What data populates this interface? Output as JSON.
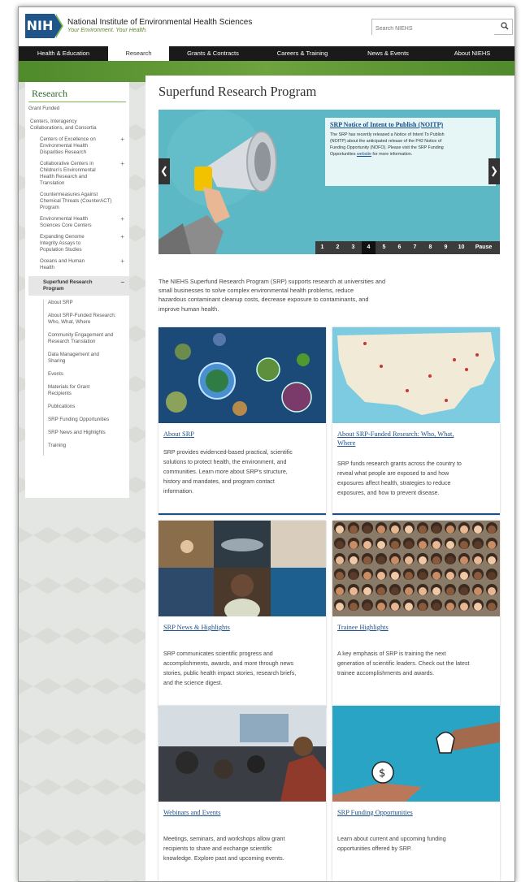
{
  "header": {
    "logo_text": "NIH",
    "institute_name": "National Institute of Environmental Health Sciences",
    "tagline": "Your Environment. Your Health.",
    "search_placeholder": "Search NIEHS"
  },
  "nav": [
    "Health & Education",
    "Research",
    "Grants & Contracts",
    "Careers & Training",
    "News & Events",
    "About NIEHS"
  ],
  "nav_active": "Research",
  "sidebar": {
    "heading": "Research",
    "grant_funded": "Grant Funded",
    "centers": [
      "Centers, Interagency",
      "Collaborations, and Consortia"
    ],
    "items": [
      {
        "lines": [
          "Centers of Excellence on",
          "Environmental Health",
          "Disparities Research"
        ],
        "expand": "+"
      },
      {
        "lines": [
          "Collaborative Centers in",
          "Children's Environmental",
          "Health Research and",
          "Translation"
        ],
        "expand": "+"
      },
      {
        "lines": [
          "Countermeasures Against",
          "Chemical Threats (CounterACT)",
          "Program"
        ],
        "expand": ""
      },
      {
        "lines": [
          "Environmental Health",
          "Sciences Core Centers"
        ],
        "expand": "+"
      },
      {
        "lines": [
          "Expanding Genome",
          "Integrity Assays to",
          "Population Studies"
        ],
        "expand": "+"
      },
      {
        "lines": [
          "Oceans and Human",
          "Health"
        ],
        "expand": "+"
      }
    ],
    "current": {
      "lines": [
        "Superfund Research",
        "Program"
      ],
      "expand": "−"
    },
    "subitems": [
      [
        "About SRP"
      ],
      [
        "About SRP-Funded Research:",
        "Who, What, Where"
      ],
      [
        "Community Engagement and",
        "Research Translation"
      ],
      [
        "Data Management and",
        "Sharing"
      ],
      [
        "Events"
      ],
      [
        "Materials for Grant",
        "Recipients"
      ],
      [
        "Publications"
      ],
      [
        "SRP Funding Opportunities"
      ],
      [
        "SRP News and Highlights"
      ],
      [
        "Training"
      ]
    ]
  },
  "main": {
    "title": "Superfund Research Program",
    "carousel": {
      "title": "SRP Notice of Intent to Publish (NOITP)",
      "text_lines": [
        "The SRP has recently released a Notice of Intent To Publish",
        "(NOITP) about the anticipated release of the P42 Notice of",
        "Funding Opportunity (NOFO).  Please visit the SRP Funding"
      ],
      "text_last_prefix": "Opportunities ",
      "text_link": "website",
      "text_last_suffix": " for more information.",
      "pages": [
        "1",
        "2",
        "3",
        "4",
        "5",
        "6",
        "7",
        "8",
        "9",
        "10"
      ],
      "active_page": "4",
      "pause_label": "Pause"
    },
    "intro_lines": [
      "The NIEHS Superfund Research Program (SRP) supports research at universities and",
      "small businesses to solve complex environmental health problems, reduce",
      "hazardous contaminant cleanup costs, decrease exposure to contaminants, and",
      "improve human health."
    ],
    "cards": [
      {
        "title_lines": [
          "About SRP"
        ],
        "desc_lines": [
          "SRP provides evidenced-based practical, scientific",
          "solutions to protect health, the environment, and",
          "communities. Learn more about SRP's structure,",
          "history and mandates, and program contact",
          "information."
        ]
      },
      {
        "title_lines": [
          "About SRP-Funded Research: Who, What,",
          "Where"
        ],
        "desc_lines": [
          "SRP funds research grants across the country to",
          "reveal what people are exposed to and how",
          "exposures affect health, strategies to reduce",
          "exposures, and how to prevent disease."
        ]
      },
      {
        "title_lines": [
          "SRP News & Highlights"
        ],
        "desc_lines": [
          "SRP communicates scientific progress and",
          "accomplishments, awards, and more through news",
          "stories, public health impact stories, research briefs,",
          "and the science digest."
        ]
      },
      {
        "title_lines": [
          "Trainee Highlights"
        ],
        "desc_lines": [
          "A key emphasis of SRP is training the next",
          "generation of scientific leaders. Check out the latest",
          "trainee accomplishments and awards."
        ]
      },
      {
        "title_lines": [
          "Webinars and Events"
        ],
        "desc_lines": [
          "Meetings, seminars, and workshops allow grant",
          "recipients to share and exchange scientific",
          "knowledge. Explore past and upcoming events."
        ]
      },
      {
        "title_lines": [
          "SRP Funding Opportunities"
        ],
        "desc_lines": [
          "Learn about current and upcoming funding",
          "opportunities offered by SRP."
        ]
      }
    ]
  },
  "colors": {
    "nih_blue": "#20558a",
    "nav_black": "#1a1a1a",
    "green_band": "#6ea33e",
    "link_blue": "#1b4f8a",
    "carousel_teal": "#5bb8c4"
  }
}
